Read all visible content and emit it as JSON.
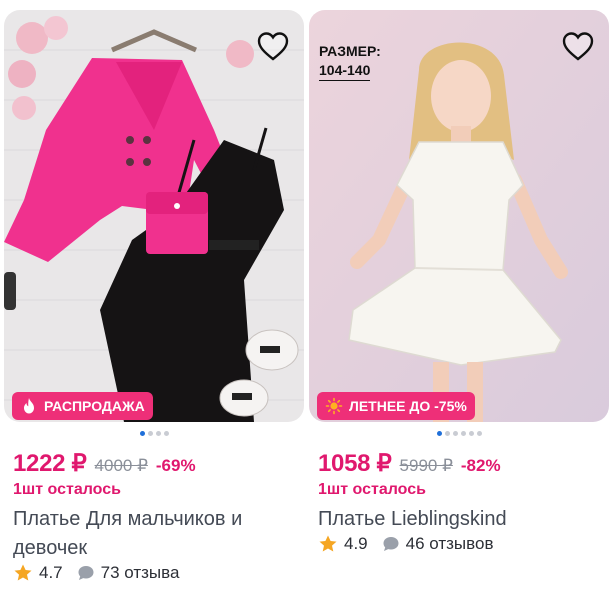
{
  "products": [
    {
      "badge": "РАСПРОДАЖА",
      "price": "1222 ₽",
      "old_price": "4000 ₽",
      "discount": "-69%",
      "stock": "1шт осталось",
      "name": "Платье Для мальчиков и девочек",
      "rating": "4.7",
      "reviews": "73 отзыва",
      "image_pages": 4,
      "active_page": 1
    },
    {
      "size_label": "РАЗМЕР:",
      "size_value": "104-140",
      "badge": "ЛЕТНЕЕ ДО -75%",
      "price": "1058 ₽",
      "old_price": "5990 ₽",
      "discount": "-82%",
      "stock": "1шт осталось",
      "name": "Платье Lieblingskind",
      "rating": "4.9",
      "reviews": "46 отзывов",
      "image_pages": 6,
      "active_page": 1
    }
  ],
  "colors": {
    "accent": "#e0186e",
    "badge": "#ee2f78",
    "dot_active": "#1f6fd9",
    "star": "#f5a623"
  },
  "icons": {
    "favorite": "heart-outline-icon",
    "sale": "fire-icon",
    "summer": "sun-icon",
    "rating": "star-icon",
    "reviews": "chat-bubble-icon"
  }
}
